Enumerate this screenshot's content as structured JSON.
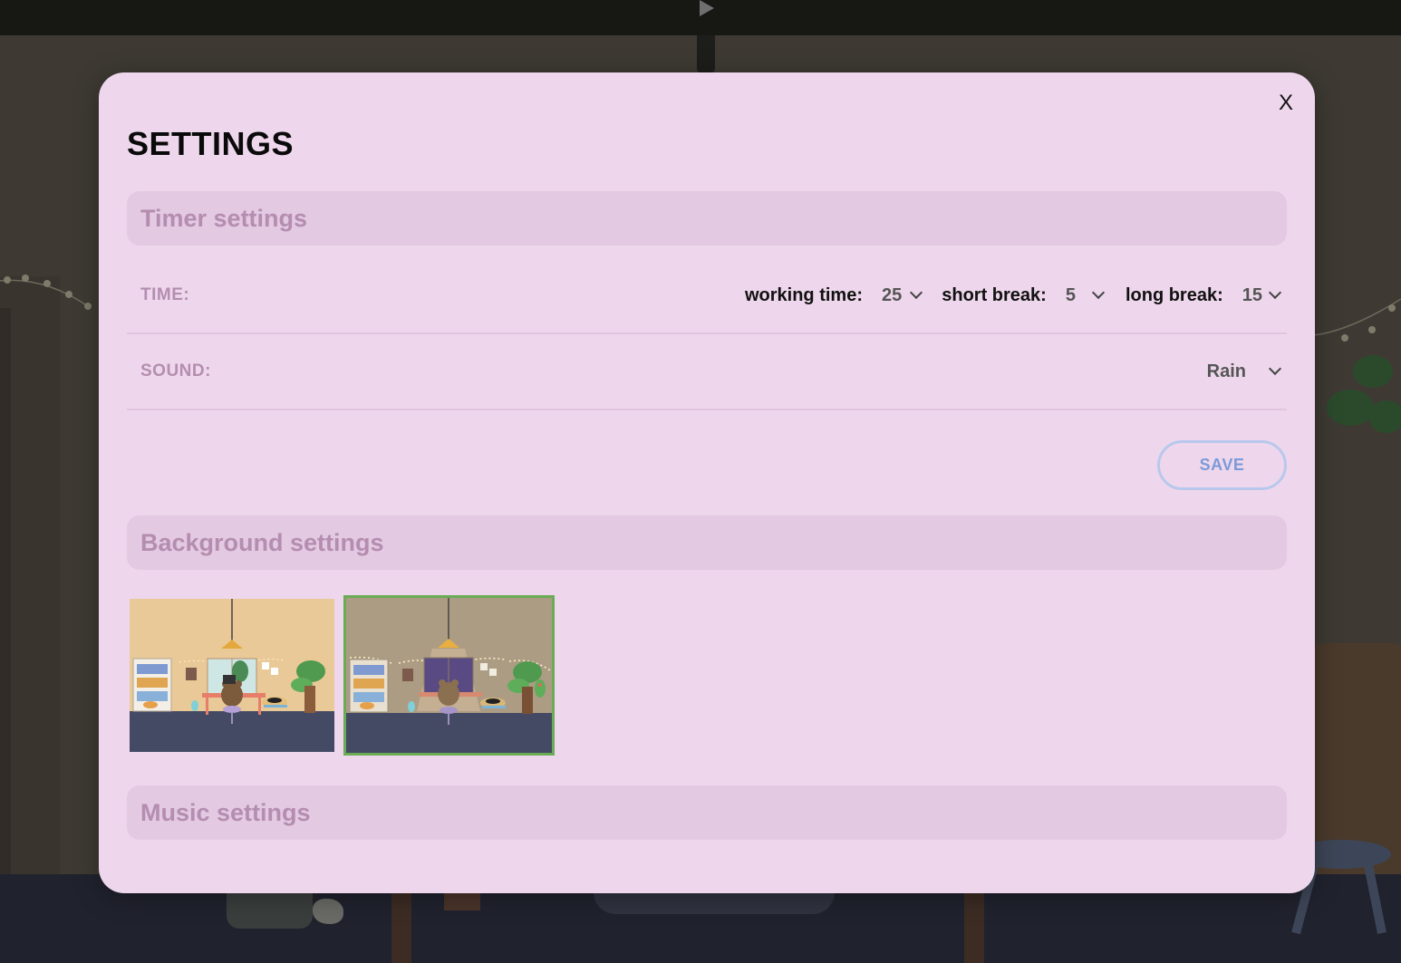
{
  "modal": {
    "close_label": "X",
    "title": "SETTINGS"
  },
  "timer_settings": {
    "heading": "Timer settings",
    "time": {
      "label": "TIME:",
      "working_time_label": "working time:",
      "working_time_value": "25",
      "short_break_label": "short break:",
      "short_break_value": "5",
      "long_break_label": "long break:",
      "long_break_value": "15"
    },
    "sound": {
      "label": "SOUND:",
      "value": "Rain"
    },
    "save_label": "SAVE"
  },
  "background_settings": {
    "heading": "Background settings",
    "options": [
      {
        "name": "day-room",
        "selected": false
      },
      {
        "name": "night-room",
        "selected": true
      }
    ],
    "selected_border_color": "#6aab55"
  },
  "music_settings": {
    "heading": "Music settings"
  },
  "colors": {
    "modal_bg": "#eed7ec",
    "section_header_bg": "#e3c9e1",
    "section_header_text": "#b48db0",
    "save_button_border": "#b8c8ec",
    "save_button_text": "#7c9ad8"
  }
}
